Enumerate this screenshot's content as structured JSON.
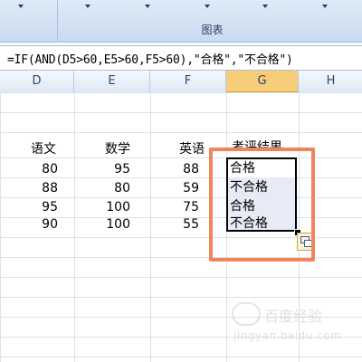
{
  "ribbon": {
    "group_label": "图表"
  },
  "formula_bar": {
    "formula": "=IF(AND(D5>60,E5>60,F5>60),\"合格\",\"不合格\")"
  },
  "columns": [
    "D",
    "E",
    "F",
    "G",
    "H"
  ],
  "selected_column": "G",
  "headers": {
    "d": "语文",
    "e": "数学",
    "f": "英语",
    "g": "考评结果"
  },
  "rows": [
    {
      "d": "80",
      "e": "95",
      "f": "88",
      "g": "合格"
    },
    {
      "d": "88",
      "e": "80",
      "f": "59",
      "g": "不合格"
    },
    {
      "d": "95",
      "e": "100",
      "f": "75",
      "g": "合格"
    },
    {
      "d": "90",
      "e": "100",
      "f": "55",
      "g": "不合格"
    }
  ],
  "watermark": {
    "line1": "百度经验",
    "line2": "jingyan.baidu.com"
  }
}
